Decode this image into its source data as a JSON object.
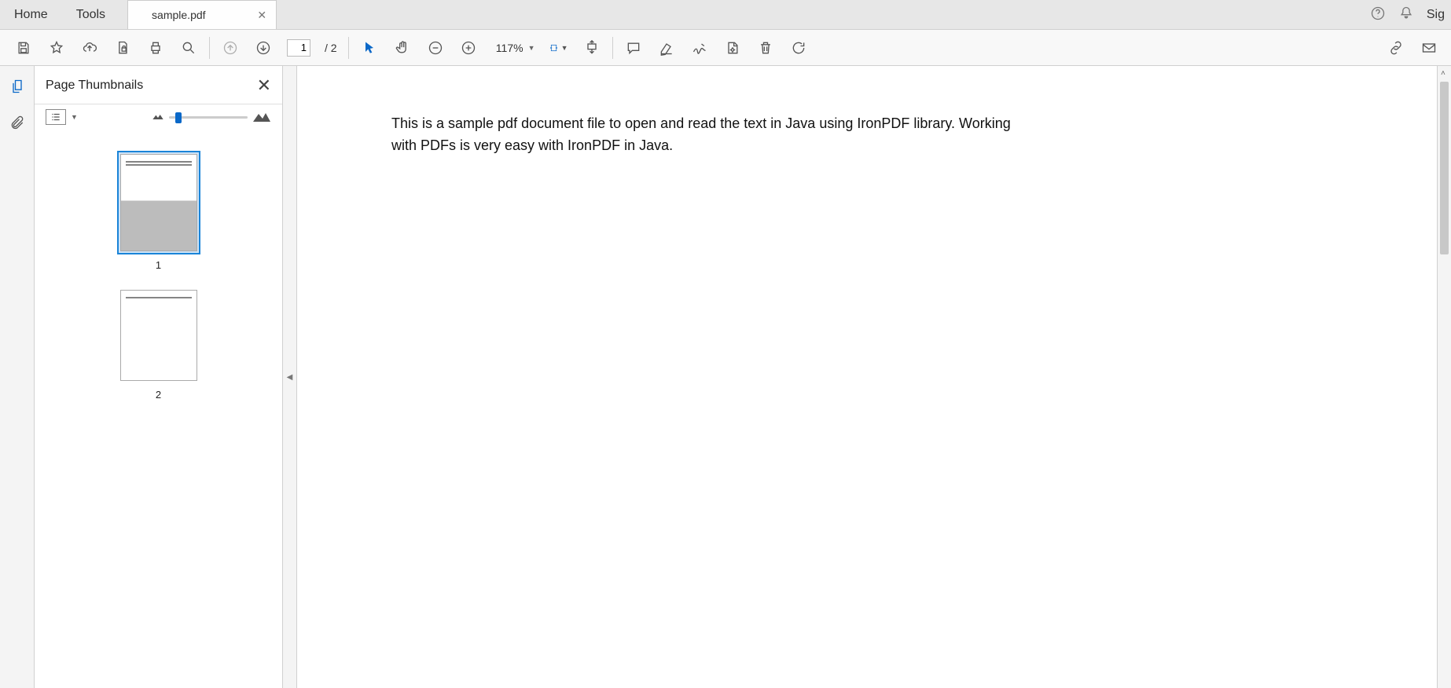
{
  "tabs": {
    "home": "Home",
    "tools": "Tools",
    "doc": "sample.pdf",
    "sign": "Sig"
  },
  "toolbar": {
    "current_page": "1",
    "total_pages": "/ 2",
    "zoom": "117%"
  },
  "thumbs": {
    "title": "Page Thumbnails",
    "pages": [
      {
        "num": "1"
      },
      {
        "num": "2"
      }
    ]
  },
  "document": {
    "body": "This is a sample pdf document file to open and read the text in Java using IronPDF library. Working with PDFs is very easy with IronPDF in Java."
  }
}
